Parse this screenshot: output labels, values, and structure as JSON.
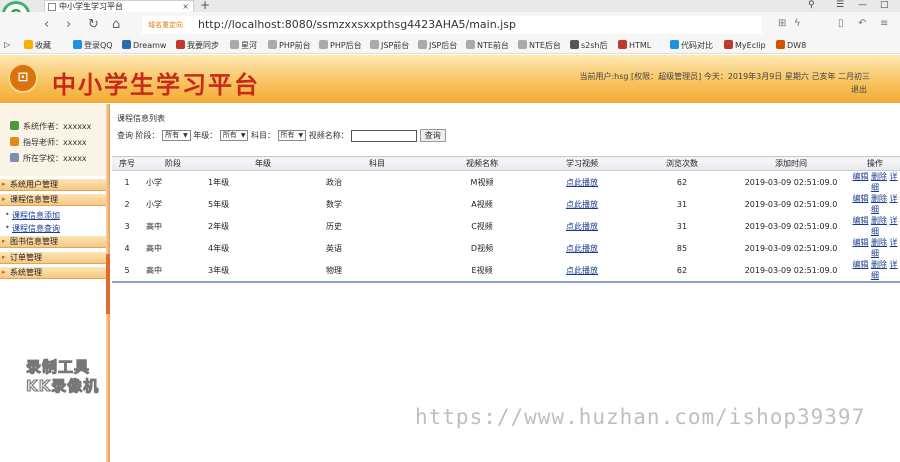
{
  "browser": {
    "tab_title": "中小学生学习平台",
    "url_hint": "域名重定向",
    "url": "http://localhost:8080/ssmzxxsxxpthsg4423AHA5/main.jsp",
    "bookmarks": [
      "收藏",
      "登录QQ",
      "Dreamw",
      "我要同步",
      "星河",
      "PHP前台",
      "PHP后台",
      "JSP前台",
      "JSP后台",
      "NTE前台",
      "NTE后台",
      "s2sh后",
      "HTML",
      "代码对比",
      "MyEclip",
      "DW8"
    ],
    "bookmark_colors": [
      "#f0b400",
      "#1f8fe0",
      "#2b6cb0",
      "#c0392b",
      "#aaaaaa",
      "#aaaaaa",
      "#aaaaaa",
      "#aaaaaa",
      "#aaaaaa",
      "#aaaaaa",
      "#aaaaaa",
      "#555555",
      "#c0392b",
      "#1f8fe0",
      "#c0392b",
      "#d35400"
    ]
  },
  "header": {
    "app_title": "中小学生学习平台",
    "user_info": "当前用户:hsg [权限：超级管理员] 今天：2019年3月9日 星期六 己亥年 二月初三",
    "logout_label": "退出"
  },
  "sidebar": {
    "info": [
      {
        "label": "系统作者：xxxxxx",
        "icon": "author-icon",
        "color": "#4a9a3a"
      },
      {
        "label": "指导老师：xxxxx",
        "icon": "teacher-icon",
        "color": "#e08a1a"
      },
      {
        "label": "所在学校：xxxxx",
        "icon": "school-icon",
        "color": "#7d8fb0"
      }
    ],
    "menus": {
      "user_mgmt": "系统用户管理",
      "course_mgmt": "课程信息管理",
      "course_add": "课程信息添加",
      "course_query": "课程信息查询",
      "book_mgmt": "图书信息管理",
      "order_mgmt": "订单管理",
      "system_mgmt": "系统管理"
    }
  },
  "overlay": {
    "rec_line1": "录制工具",
    "rec_line2": "KK录像机",
    "site_watermark": "https://www.huzhan.com/ishop39397"
  },
  "main": {
    "caption": "课程信息列表",
    "search": {
      "query_label": "查询",
      "stage_label": "阶段：",
      "stage_value": "所有",
      "grade_label": "年级：",
      "grade_value": "所有",
      "subject_label": "科目：",
      "subject_value": "所有",
      "video_label": "视频名称：",
      "video_value": "",
      "button": "查询"
    },
    "columns": [
      "序号",
      "阶段",
      "年级",
      "科目",
      "视频名称",
      "学习视频",
      "浏览次数",
      "添加时间",
      "操作"
    ],
    "rows": [
      {
        "no": "1",
        "stage": "小学",
        "grade": "1年级",
        "subject": "政治",
        "video": "M视频",
        "play": "点此播放",
        "views": "62",
        "time": "2019-03-09 02:51:09.0"
      },
      {
        "no": "2",
        "stage": "小学",
        "grade": "5年级",
        "subject": "数学",
        "video": "A视频",
        "play": "点此播放",
        "views": "31",
        "time": "2019-03-09 02:51:09.0"
      },
      {
        "no": "3",
        "stage": "高中",
        "grade": "2年级",
        "subject": "历史",
        "video": "C视频",
        "play": "点此播放",
        "views": "31",
        "time": "2019-03-09 02:51:09.0"
      },
      {
        "no": "4",
        "stage": "高中",
        "grade": "4年级",
        "subject": "英语",
        "video": "D视频",
        "play": "点此播放",
        "views": "85",
        "time": "2019-03-09 02:51:09.0"
      },
      {
        "no": "5",
        "stage": "高中",
        "grade": "3年级",
        "subject": "物理",
        "video": "E视频",
        "play": "点此播放",
        "views": "62",
        "time": "2019-03-09 02:51:09.0"
      }
    ],
    "actions": {
      "edit": "编辑",
      "delete": "删除",
      "detail": "详细"
    }
  }
}
